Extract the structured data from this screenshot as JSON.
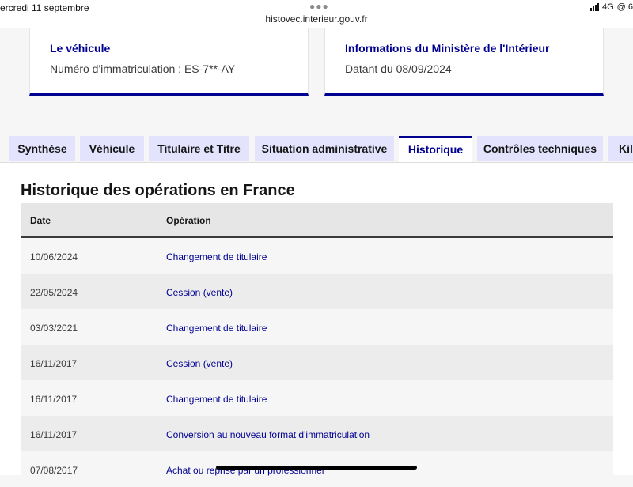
{
  "status_bar": {
    "date": "ercredi 11 septembre",
    "url": "histovec.interieur.gouv.fr",
    "network": "4G",
    "extra": "@ 6"
  },
  "cards": {
    "vehicle": {
      "title": "Le véhicule",
      "text": "Numéro d'immatriculation : ES-7**-AY"
    },
    "ministry": {
      "title": "Informations du Ministère de l'Intérieur",
      "text": "Datant du 08/09/2024"
    }
  },
  "tabs": [
    {
      "label": "Synthèse",
      "active": false
    },
    {
      "label": "Véhicule",
      "active": false
    },
    {
      "label": "Titulaire et Titre",
      "active": false
    },
    {
      "label": "Situation administrative",
      "active": false
    },
    {
      "label": "Historique",
      "active": true
    },
    {
      "label": "Contrôles techniques",
      "active": false
    },
    {
      "label": "Kilométrage",
      "active": false
    }
  ],
  "history": {
    "title": "Historique des opérations en France",
    "columns": {
      "date": "Date",
      "operation": "Opération"
    },
    "rows": [
      {
        "date": "10/06/2024",
        "operation": "Changement de titulaire"
      },
      {
        "date": "22/05/2024",
        "operation": "Cession (vente)"
      },
      {
        "date": "03/03/2021",
        "operation": "Changement de titulaire"
      },
      {
        "date": "16/11/2017",
        "operation": "Cession (vente)"
      },
      {
        "date": "16/11/2017",
        "operation": "Changement de titulaire"
      },
      {
        "date": "16/11/2017",
        "operation": "Conversion au nouveau format d'immatriculation"
      },
      {
        "date": "07/08/2017",
        "operation": "Achat ou reprise par un professionnel"
      }
    ]
  },
  "colors": {
    "accent": "#000091",
    "tab_background": "#e3e3fd"
  }
}
